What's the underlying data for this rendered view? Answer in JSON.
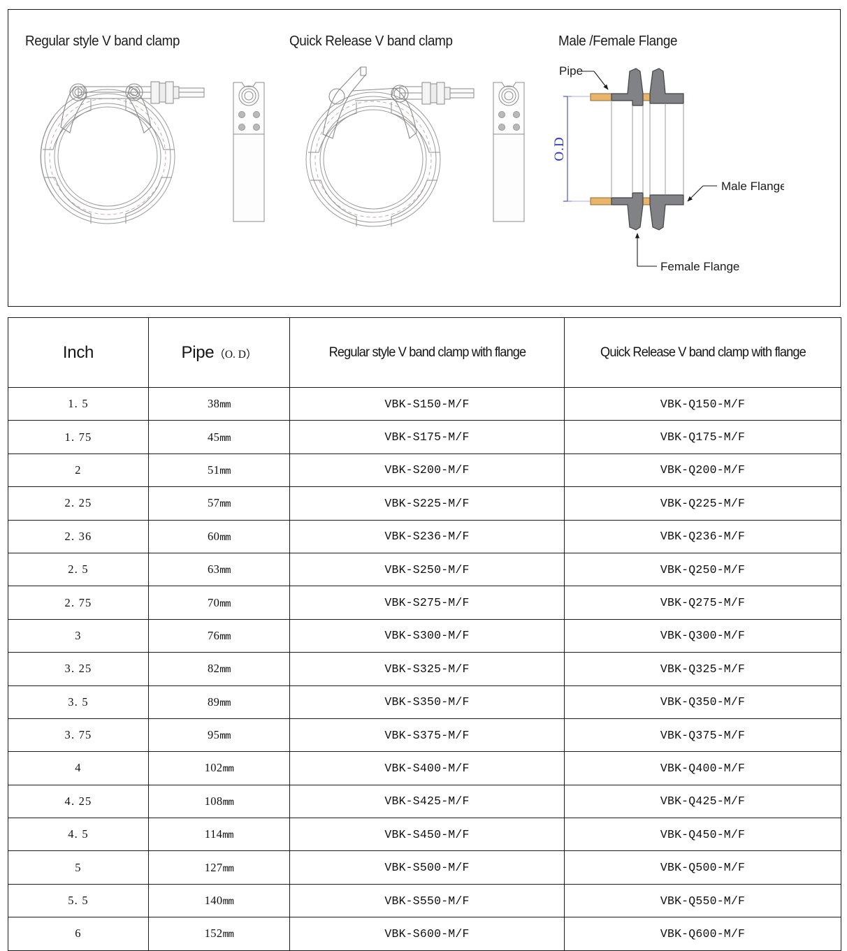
{
  "figures": {
    "regular_title": "Regular style V band clamp",
    "quick_title": "Quick Release V band clamp",
    "flange_title": "Male /Female Flange",
    "labels": {
      "pipe": "Pipe",
      "od": "O.D",
      "male_flange": "Male Flange",
      "female_flange": "Female Flange"
    },
    "colors": {
      "pipe_fill": "#e8b56a",
      "pipe_stroke": "#8a6a33",
      "flange_fill": "#808285",
      "flange_stroke": "#3f4144",
      "dimension_blue": "#2a36c0",
      "line_art": "#9a9a9a",
      "line_art_dark": "#6f6f6f"
    }
  },
  "table": {
    "headers": [
      "Inch",
      "Pipe",
      "Regular style V band clamp with flange",
      "Quick Release V band clamp with flange"
    ],
    "pipe_header_suffix": "（O. D）",
    "rows": [
      {
        "inch": "1. 5",
        "pipe": "38",
        "unit": "mm",
        "regular": "VBK-S150-M/F",
        "quick": "VBK-Q150-M/F"
      },
      {
        "inch": "1. 75",
        "pipe": "45",
        "unit": "mm",
        "regular": "VBK-S175-M/F",
        "quick": "VBK-Q175-M/F"
      },
      {
        "inch": "2",
        "pipe": "51",
        "unit": "mm",
        "regular": "VBK-S200-M/F",
        "quick": "VBK-Q200-M/F"
      },
      {
        "inch": "2. 25",
        "pipe": "57",
        "unit": "mm",
        "regular": "VBK-S225-M/F",
        "quick": "VBK-Q225-M/F"
      },
      {
        "inch": "2. 36",
        "pipe": "60",
        "unit": "mm",
        "regular": "VBK-S236-M/F",
        "quick": "VBK-Q236-M/F"
      },
      {
        "inch": "2. 5",
        "pipe": "63",
        "unit": "mm",
        "regular": "VBK-S250-M/F",
        "quick": "VBK-Q250-M/F"
      },
      {
        "inch": "2. 75",
        "pipe": "70",
        "unit": "mm",
        "regular": "VBK-S275-M/F",
        "quick": "VBK-Q275-M/F"
      },
      {
        "inch": "3",
        "pipe": "76",
        "unit": "mm",
        "regular": "VBK-S300-M/F",
        "quick": "VBK-Q300-M/F"
      },
      {
        "inch": "3. 25",
        "pipe": "82",
        "unit": "mm",
        "regular": "VBK-S325-M/F",
        "quick": "VBK-Q325-M/F"
      },
      {
        "inch": "3. 5",
        "pipe": "89",
        "unit": "mm",
        "regular": "VBK-S350-M/F",
        "quick": "VBK-Q350-M/F"
      },
      {
        "inch": "3. 75",
        "pipe": "95",
        "unit": "mm",
        "regular": "VBK-S375-M/F",
        "quick": "VBK-Q375-M/F"
      },
      {
        "inch": "4",
        "pipe": "102",
        "unit": "mm",
        "regular": "VBK-S400-M/F",
        "quick": "VBK-Q400-M/F"
      },
      {
        "inch": "4. 25",
        "pipe": "108",
        "unit": "mm",
        "regular": "VBK-S425-M/F",
        "quick": "VBK-Q425-M/F"
      },
      {
        "inch": "4. 5",
        "pipe": "114",
        "unit": "mm",
        "regular": "VBK-S450-M/F",
        "quick": "VBK-Q450-M/F"
      },
      {
        "inch": "5",
        "pipe": "127",
        "unit": "mm",
        "regular": "VBK-S500-M/F",
        "quick": "VBK-Q500-M/F"
      },
      {
        "inch": "5. 5",
        "pipe": "140",
        "unit": "mm",
        "regular": "VBK-S550-M/F",
        "quick": "VBK-Q550-M/F"
      },
      {
        "inch": "6",
        "pipe": "152",
        "unit": "mm",
        "regular": "VBK-S600-M/F",
        "quick": "VBK-Q600-M/F"
      }
    ]
  }
}
